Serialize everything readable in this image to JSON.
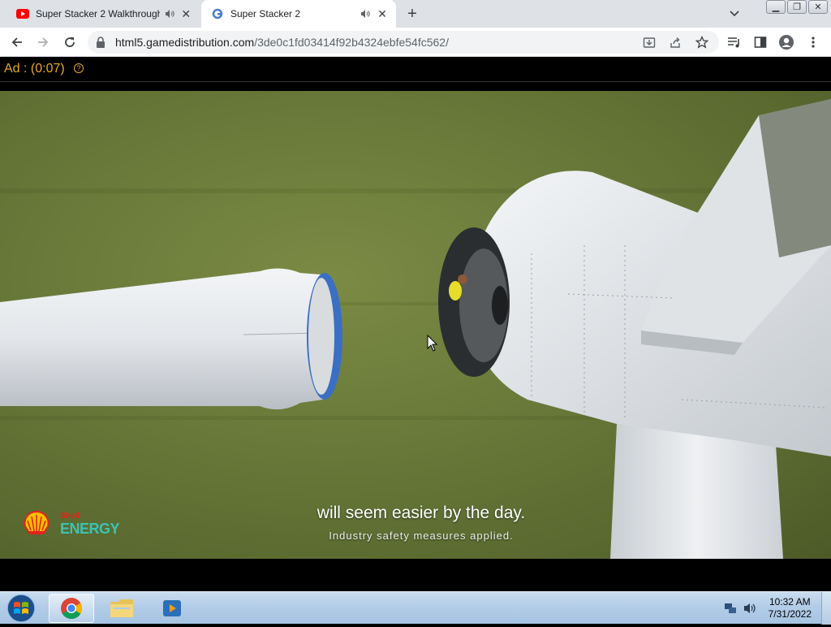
{
  "browser": {
    "tabs": [
      {
        "title": "Super Stacker 2 Walkthrough",
        "favicon": "youtube-icon",
        "active": false
      },
      {
        "title": "Super Stacker 2",
        "favicon": "gamedistribution-icon",
        "active": true
      }
    ],
    "address": {
      "host": "html5.gamedistribution.com",
      "path": "/3de0c1fd03414f92b4324ebfe54fc562/"
    },
    "toolbar_icons": [
      "back-icon",
      "forward-icon",
      "reload-icon",
      "lock-icon",
      "install-icon",
      "share-icon",
      "star-icon",
      "media-control-icon",
      "side-panel-icon",
      "profile-icon",
      "menu-icon"
    ]
  },
  "ad": {
    "label": "Ad : (0:07)",
    "help": "?"
  },
  "video": {
    "caption_main": "will seem easier by the day.",
    "caption_sub": "Industry safety measures applied.",
    "brand_top": "Shell",
    "brand_bottom": "ENERGY",
    "colors": {
      "grass": "#6a7a3a",
      "turbine": "#dfe3e6",
      "blade_ring": "#3a6fc4",
      "brand_red": "#e2231a",
      "brand_teal": "#3cc3b4",
      "shell_yellow": "#f6c000"
    }
  },
  "taskbar": {
    "apps": [
      "chrome-icon",
      "file-explorer-icon",
      "media-player-icon"
    ],
    "time": "10:32 AM",
    "date": "7/31/2022"
  }
}
